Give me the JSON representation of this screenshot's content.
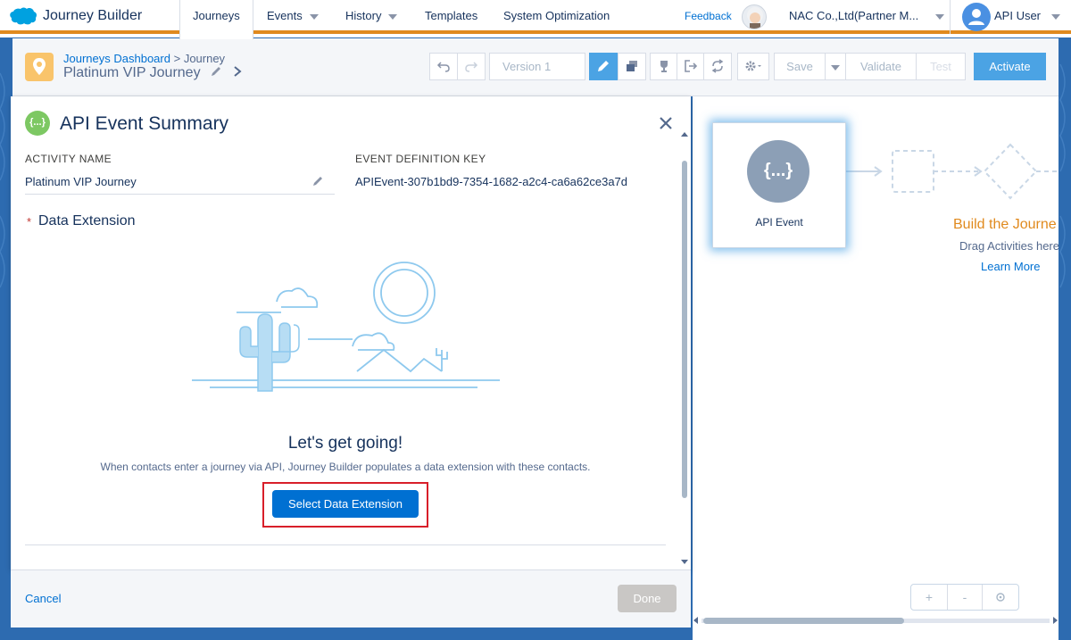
{
  "app": {
    "title": "Journey Builder"
  },
  "nav": {
    "tabs": [
      {
        "label": "Journeys",
        "active": true
      },
      {
        "label": "Events"
      },
      {
        "label": "History"
      },
      {
        "label": "Templates"
      },
      {
        "label": "System Optimization"
      }
    ],
    "feedback": "Feedback",
    "org": "NAC Co.,Ltd(Partner M...",
    "user": "API User"
  },
  "header": {
    "breadcrumb_link": "Journeys Dashboard",
    "breadcrumb_sep": ">",
    "breadcrumb_current": "Journey",
    "journey_name": "Platinum VIP Journey",
    "version": "Version 1",
    "save": "Save",
    "validate": "Validate",
    "test": "Test",
    "activate": "Activate"
  },
  "panel": {
    "icon_text": "{...}",
    "title": "API Event Summary",
    "activity_name_label": "ACTIVITY NAME",
    "activity_name_value": "Platinum VIP Journey",
    "event_key_label": "EVENT DEFINITION KEY",
    "event_key_value": "APIEvent-307b1bd9-7354-1682-a2c4-ca6a62ce3a7d",
    "required_marker": "*",
    "data_extension_label": "Data Extension",
    "going_title": "Let's get going!",
    "going_sub": "When contacts enter a journey via API, Journey Builder populates a data extension with these contacts.",
    "select_button": "Select Data Extension",
    "cancel": "Cancel",
    "done": "Done"
  },
  "canvas": {
    "event_icon_text": "{...}",
    "event_label": "API Event",
    "build_title": "Build the Journe",
    "build_sub": "Drag Activities here",
    "learn_more": "Learn More",
    "zoom_in": "+",
    "zoom_out": "-"
  },
  "colors": {
    "accent_orange": "#e08a1e",
    "brand_blue": "#0070d2",
    "highlight_red": "#d81f2a"
  }
}
